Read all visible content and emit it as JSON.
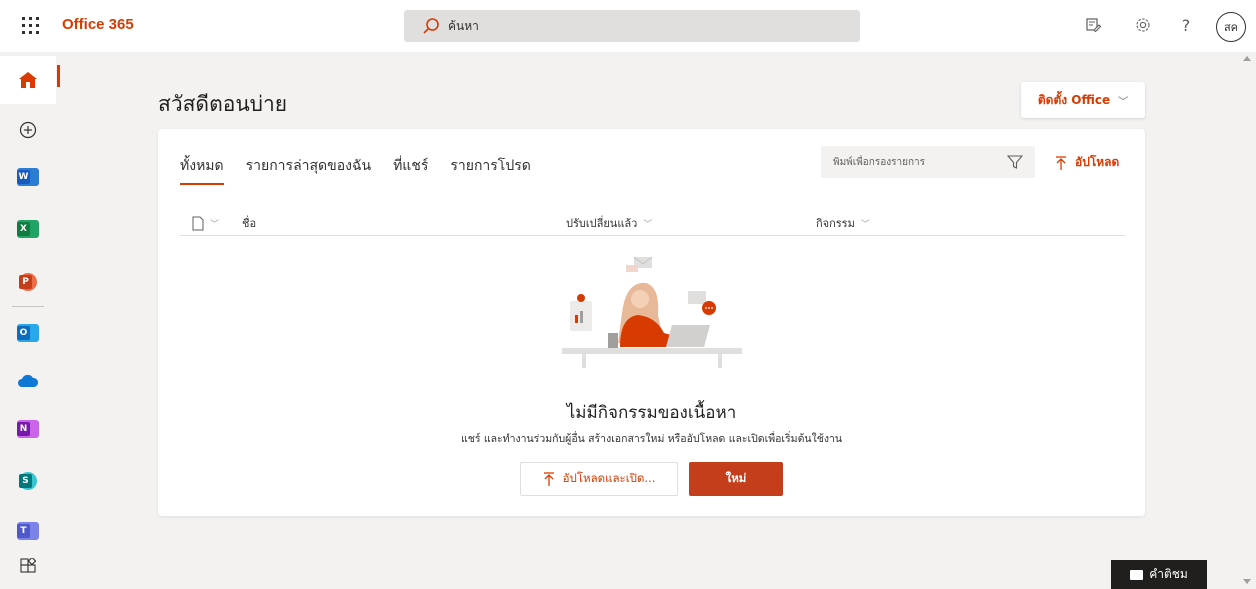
{
  "topbar": {
    "brand": "Office 365",
    "search_placeholder": "ค้นหา",
    "avatar_initials": "สค"
  },
  "rail": {
    "items": [
      {
        "name": "home",
        "icon": "home-icon"
      },
      {
        "name": "create",
        "icon": "plus-circle-icon"
      },
      {
        "name": "word",
        "icon": "word-icon",
        "letter": "W",
        "color": "#185abd"
      },
      {
        "name": "excel",
        "icon": "excel-icon",
        "letter": "X",
        "color": "#107c41"
      },
      {
        "name": "powerpoint",
        "icon": "powerpoint-icon",
        "letter": "P",
        "color": "#c43e1c"
      },
      {
        "name": "outlook",
        "icon": "outlook-icon",
        "letter": "O",
        "color": "#0f6cbd"
      },
      {
        "name": "onedrive",
        "icon": "onedrive-icon",
        "color": "#0f78d4"
      },
      {
        "name": "onenote",
        "icon": "onenote-icon",
        "letter": "N",
        "color": "#7719aa"
      },
      {
        "name": "sharepoint",
        "icon": "sharepoint-icon",
        "letter": "S",
        "color": "#03787c"
      },
      {
        "name": "teams",
        "icon": "teams-icon",
        "letter": "T",
        "color": "#5059c9"
      },
      {
        "name": "all-apps",
        "icon": "apps-grid-icon"
      }
    ]
  },
  "main": {
    "greeting": "สวัสดีตอนบ่าย",
    "install_label": "ติดตั้ง Office",
    "tabs": [
      "ทั้งหมด",
      "รายการล่าสุดของฉัน",
      "ที่แชร์",
      "รายการโปรด"
    ],
    "filter_placeholder": "พิมพ์เพื่อกรองรายการ",
    "upload_label": "อัปโหลด",
    "columns": {
      "name": "ชื่อ",
      "modified": "ปรับเปลี่ยนแล้ว",
      "activity": "กิจกรรม"
    },
    "empty_title": "ไม่มีกิจกรรมของเนื้อหา",
    "empty_desc": "แชร์ และทำงานร่วมกับผู้อื่น สร้างเอกสารใหม่ หรืออัปโหลด และเปิดเพื่อเริ่มต้นใช้งาน",
    "upload_open_label": "อัปโหลดและเปิด...",
    "new_label": "ใหม่"
  },
  "feedback_label": "คำติชม",
  "colors": {
    "accent": "#d83b01",
    "primary_button": "#c43e1c"
  }
}
